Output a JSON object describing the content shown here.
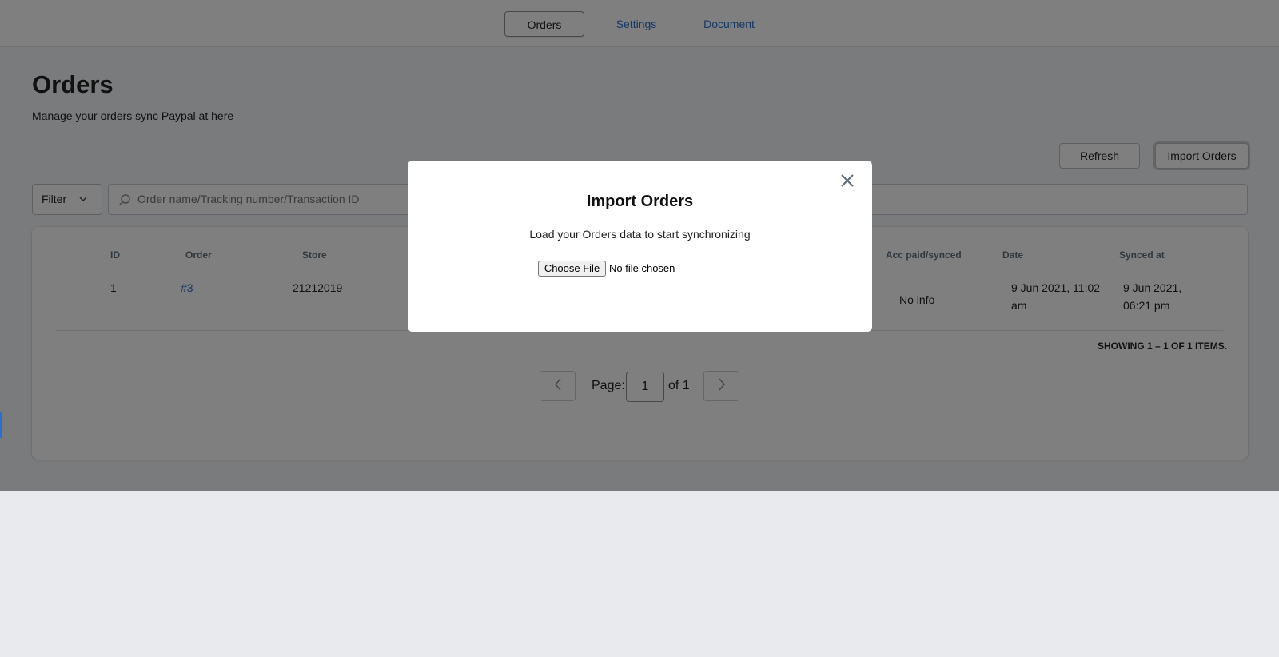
{
  "nav": {
    "tabs": [
      {
        "label": "Orders"
      },
      {
        "label": "Settings"
      },
      {
        "label": "Document"
      }
    ]
  },
  "page": {
    "title": "Orders",
    "subtitle": "Manage your orders sync Paypal at here"
  },
  "actions": {
    "refresh_label": "Refresh",
    "import_label": "Import Orders"
  },
  "filter": {
    "label": "Filter",
    "search_placeholder": "Order name/Tracking number/Transaction ID"
  },
  "table": {
    "columns": [
      "ID",
      "Order",
      "Store",
      "Acc paid/synced",
      "Date",
      "Synced at"
    ],
    "rows": [
      {
        "id": "1",
        "order": "#3",
        "store": "21212019",
        "acc_paid": "No info",
        "date_line1": "9 Jun 2021, 11:02",
        "date_line2": "am",
        "synced_line1": "9 Jun 2021,",
        "synced_line2": "06:21 pm"
      }
    ],
    "showing": "SHOWING 1 – 1 OF 1 ITEMS."
  },
  "pagination": {
    "page_label": "Page:",
    "current_page": "1",
    "of_label": "of 1"
  },
  "modal": {
    "title": "Import Orders",
    "description": "Load your Orders data to start synchronizing",
    "choose_file_label": "Choose File",
    "file_status": "No file chosen"
  },
  "colors": {
    "accent": "#2c6ecb",
    "overlay": "rgba(0,0,0,0.5)"
  }
}
